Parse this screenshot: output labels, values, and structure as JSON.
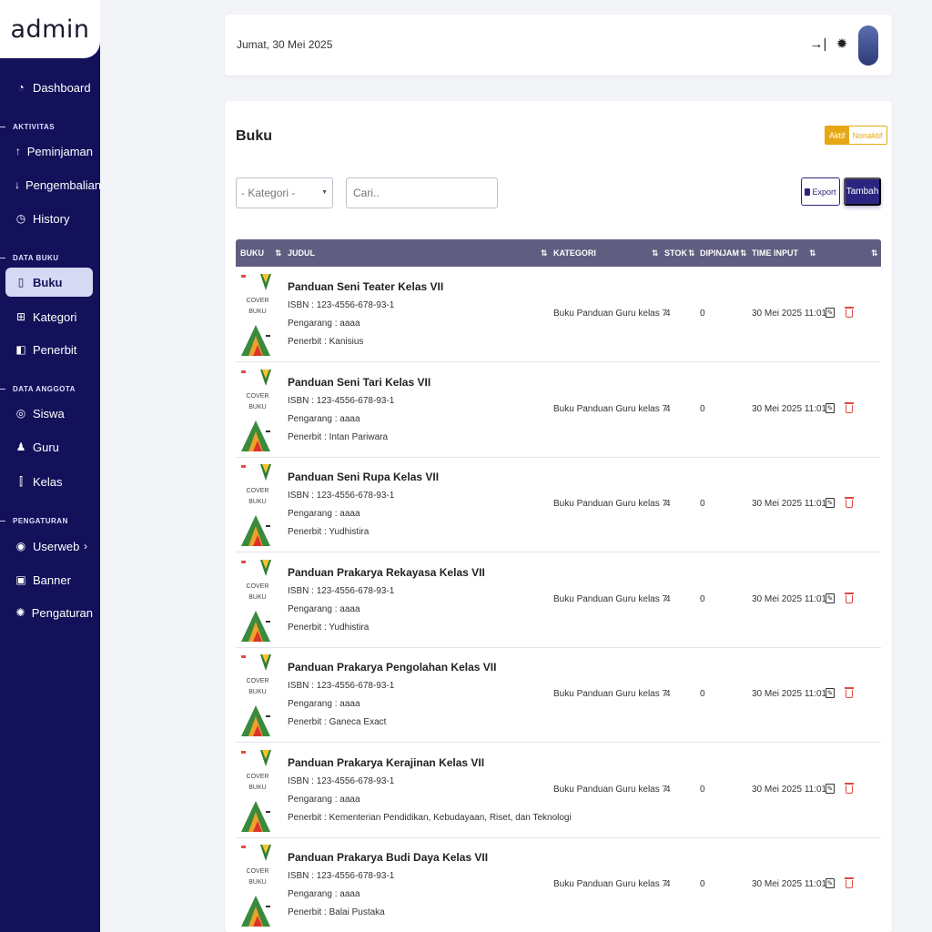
{
  "app": {
    "brand": "admin"
  },
  "sidebar": {
    "items": [
      {
        "label": "Dashboard",
        "icon": "dashboard-icon",
        "glyph": "◔"
      },
      {
        "section": "AKTIVITAS"
      },
      {
        "label": "Peminjaman",
        "icon": "arrow-up-icon",
        "glyph": "↑"
      },
      {
        "label": "Pengembalian",
        "icon": "arrow-down-icon",
        "glyph": "↓"
      },
      {
        "label": "History",
        "icon": "history-icon",
        "glyph": "◷"
      },
      {
        "section": "DATA BUKU"
      },
      {
        "label": "Buku",
        "icon": "book-icon",
        "glyph": "▯",
        "active": true
      },
      {
        "label": "Kategori",
        "icon": "category-icon",
        "glyph": "⊞"
      },
      {
        "label": "Penerbit",
        "icon": "publisher-icon",
        "glyph": "◧"
      },
      {
        "section": "DATA ANGGOTA"
      },
      {
        "label": "Siswa",
        "icon": "student-icon",
        "glyph": "◎"
      },
      {
        "label": "Guru",
        "icon": "teacher-icon",
        "glyph": "♟"
      },
      {
        "label": "Kelas",
        "icon": "class-icon",
        "glyph": "⫿"
      },
      {
        "section": "PENGATURAN"
      },
      {
        "label": "Userweb",
        "icon": "userweb-icon",
        "glyph": "◉",
        "chevron": "›"
      },
      {
        "label": "Banner",
        "icon": "banner-icon",
        "glyph": "▣"
      },
      {
        "label": "Pengaturan",
        "icon": "settings-icon",
        "glyph": "✺"
      }
    ]
  },
  "header": {
    "date": "Jumat, 30 Mei 2025",
    "icons": {
      "collapse": "→|",
      "bug": "✹"
    }
  },
  "card": {
    "title": "Buku",
    "toggle": {
      "active": "Aktif",
      "inactive": "Nonaktif"
    },
    "filter": {
      "kategori": "- Kategori -"
    },
    "search": {
      "placeholder": "Cari.."
    },
    "export_label": "Export",
    "tambah_label": "Tambah"
  },
  "table": {
    "columns": [
      "BUKU",
      "JUDUL",
      "KATEGORI",
      "STOK",
      "DIPINJAM",
      "TIME INPUT",
      ""
    ],
    "cover_text": "COVER BUKU",
    "isbn_prefix": "ISBN : ",
    "pengarang_prefix": "Pengarang : ",
    "penerbit_prefix": "Penerbit : ",
    "rows": [
      {
        "judul": "Panduan Seni Teater Kelas VII",
        "isbn": "123-4556-678-93-1",
        "pengarang": "aaaa",
        "penerbit": "Kanisius",
        "kategori": "Buku Panduan Guru kelas 7",
        "stok": "4",
        "dipinjam": "0",
        "time": "30 Mei 2025 11:01"
      },
      {
        "judul": "Panduan Seni Tari Kelas VII",
        "isbn": "123-4556-678-93-1",
        "pengarang": "aaaa",
        "penerbit": "Intan Pariwara",
        "kategori": "Buku Panduan Guru kelas 7",
        "stok": "4",
        "dipinjam": "0",
        "time": "30 Mei 2025 11:01"
      },
      {
        "judul": "Panduan Seni Rupa Kelas VII",
        "isbn": "123-4556-678-93-1",
        "pengarang": "aaaa",
        "penerbit": "Yudhistira",
        "kategori": "Buku Panduan Guru kelas 7",
        "stok": "4",
        "dipinjam": "0",
        "time": "30 Mei 2025 11:01"
      },
      {
        "judul": "Panduan Prakarya Rekayasa Kelas VII",
        "isbn": "123-4556-678-93-1",
        "pengarang": "aaaa",
        "penerbit": "Yudhistira",
        "kategori": "Buku Panduan Guru kelas 7",
        "stok": "4",
        "dipinjam": "0",
        "time": "30 Mei 2025 11:01"
      },
      {
        "judul": "Panduan Prakarya Pengolahan Kelas VII",
        "isbn": "123-4556-678-93-1",
        "pengarang": "aaaa",
        "penerbit": "Ganeca Exact",
        "kategori": "Buku Panduan Guru kelas 7",
        "stok": "4",
        "dipinjam": "0",
        "time": "30 Mei 2025 11:01"
      },
      {
        "judul": "Panduan Prakarya Kerajinan Kelas VII",
        "isbn": "123-4556-678-93-1",
        "pengarang": "aaaa",
        "penerbit": "Kementerian Pendidikan, Kebudayaan, Riset, dan Teknologi",
        "kategori": "Buku Panduan Guru kelas 7",
        "stok": "4",
        "dipinjam": "0",
        "time": "30 Mei 2025 11:01"
      },
      {
        "judul": "Panduan Prakarya Budi Daya Kelas VII",
        "isbn": "123-4556-678-93-1",
        "pengarang": "aaaa",
        "penerbit": "Balai Pustaka",
        "kategori": "Buku Panduan Guru kelas 7",
        "stok": "4",
        "dipinjam": "0",
        "time": "30 Mei 2025 11:01"
      }
    ]
  },
  "colors": {
    "sidebar": "#13115a",
    "primary": "#2a2580",
    "accent": "#e6a817",
    "danger": "#e04a3f",
    "thead": "#605e80"
  }
}
